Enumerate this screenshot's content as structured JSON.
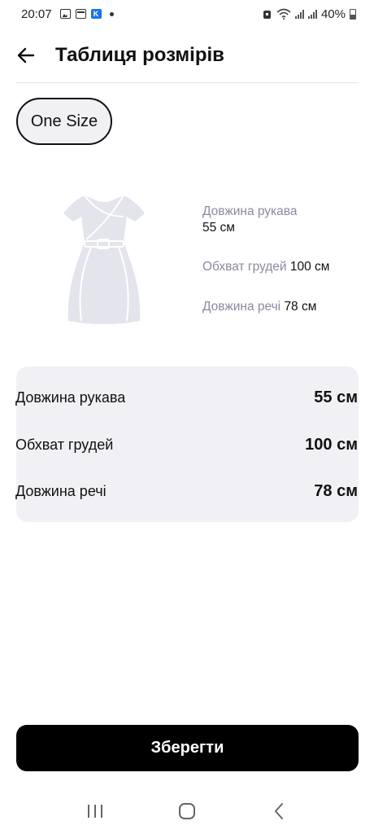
{
  "status_bar": {
    "time": "20:07",
    "battery": "40%"
  },
  "header": {
    "title": "Таблиця розмірів"
  },
  "size_chip": {
    "label": "One Size"
  },
  "illustration": {
    "sleeve": {
      "label": "Довжина рукава",
      "value": "55 см"
    },
    "chest": {
      "label": "Обхват грудей",
      "value": "100 см"
    },
    "length": {
      "label": "Довжина речі",
      "value": "78 см"
    }
  },
  "table": {
    "rows": [
      {
        "label": "Довжина рукава",
        "value": "55 см"
      },
      {
        "label": "Обхват грудей",
        "value": "100 см"
      },
      {
        "label": "Довжина речі",
        "value": "78 см"
      }
    ]
  },
  "save_button": {
    "label": "Зберегти"
  },
  "colors": {
    "accent": "#000000",
    "card_bg": "#f1f1f5",
    "muted_text": "#8a8aa0",
    "dress_fill": "#e3e4ec"
  }
}
